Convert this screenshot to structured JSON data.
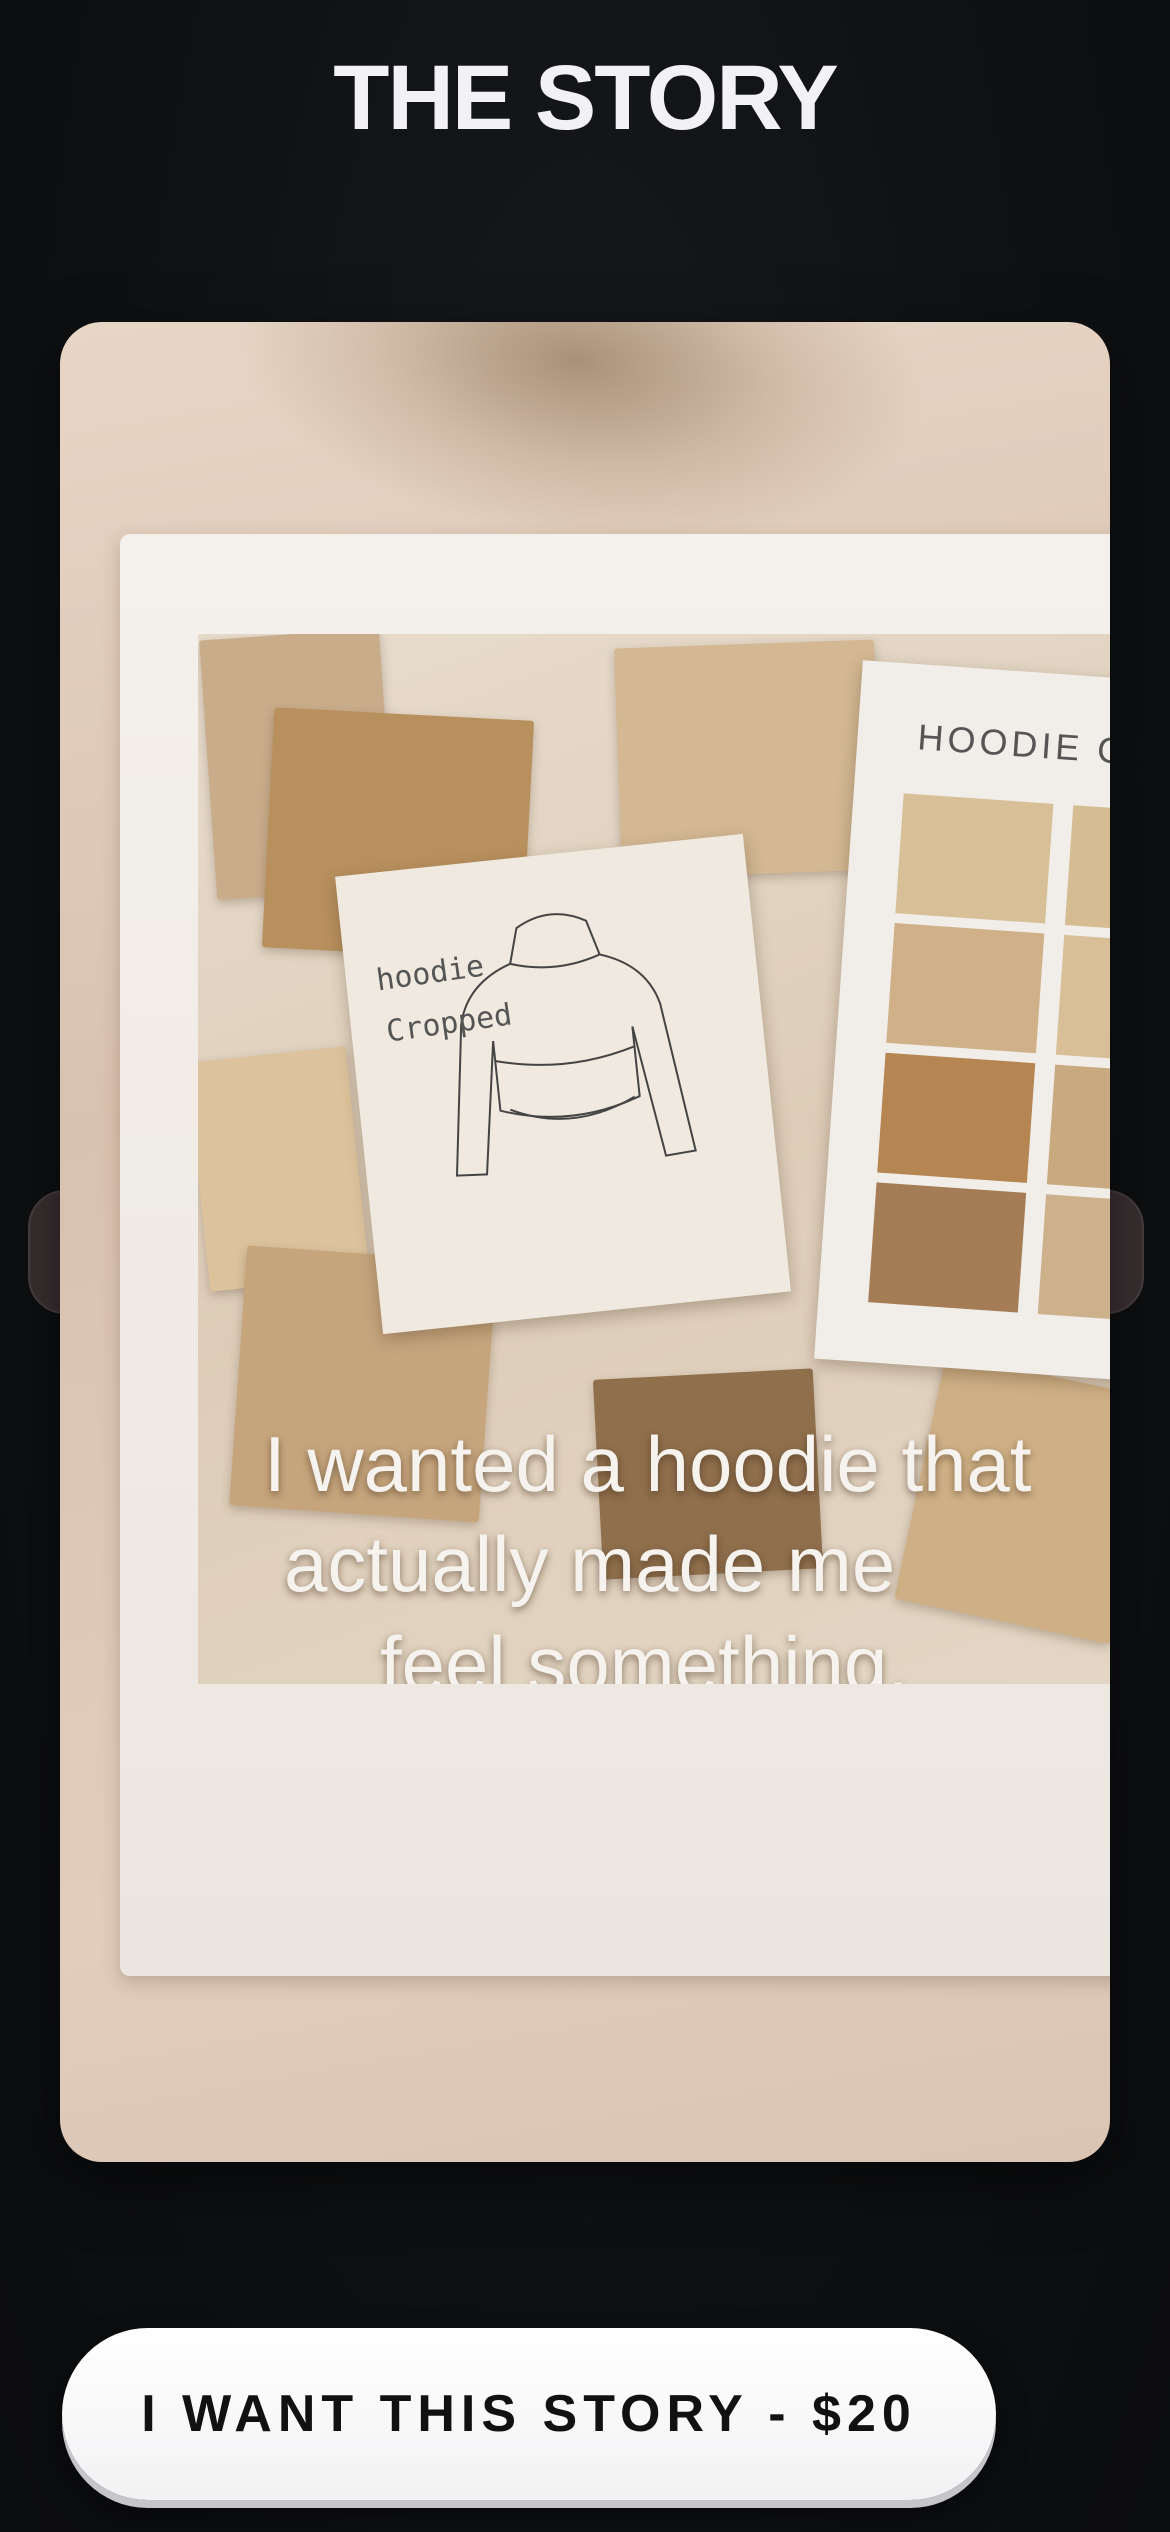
{
  "header": {
    "title": "THE STORY"
  },
  "card": {
    "palette_title": "HOODIE C",
    "sketch_note_line1": "hoodie",
    "sketch_note_line2": "Cropped",
    "caption": [
      "I wanted a hoodie that",
      "actually made me",
      "feel something."
    ]
  },
  "cta": {
    "label": "I WANT THIS STORY - $20"
  },
  "colors": {
    "background": "#0e1012",
    "title": "#f1f1f6",
    "button": "#ffffff",
    "button_text": "#111111"
  }
}
